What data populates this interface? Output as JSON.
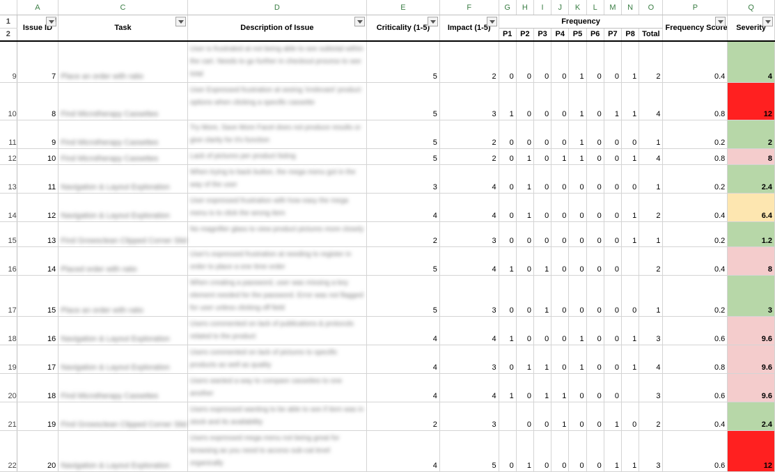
{
  "columns": [
    "A",
    "C",
    "D",
    "E",
    "F",
    "G",
    "H",
    "I",
    "J",
    "K",
    "L",
    "M",
    "N",
    "O",
    "P",
    "Q"
  ],
  "headers": {
    "issue_id": "Issue ID",
    "task": "Task",
    "description": "Description of Issue",
    "criticality": "Criticality (1-5)",
    "impact": "Impact (1-5)",
    "frequency": "Frequency",
    "p_labels": [
      "P1",
      "P2",
      "P3",
      "P4",
      "P5",
      "P6",
      "P7",
      "P8",
      "Total"
    ],
    "frequency_score": "Frequency Score",
    "severity": "Severity"
  },
  "header_rows": [
    "1",
    "2"
  ],
  "rows": [
    {
      "row": "9",
      "id": "7",
      "task": "Place an order with ratio",
      "desc": "User is frustrated at not being able to see subtotal within the cart. Needs to go further in checkout process to see total",
      "crit": "5",
      "impact": "2",
      "p": [
        "0",
        "0",
        "0",
        "0",
        "1",
        "0",
        "0",
        "1"
      ],
      "total": "2",
      "fscore": "0.4",
      "sev": "4",
      "sevclass": "g"
    },
    {
      "row": "10",
      "id": "8",
      "task": "Find Microtherapy Cassettes",
      "desc": "User Expressed frustration at seeing 'irrelevant' product options when clicking a specific cassette",
      "crit": "5",
      "impact": "3",
      "p": [
        "1",
        "0",
        "0",
        "0",
        "1",
        "0",
        "1",
        "1"
      ],
      "total": "4",
      "fscore": "0.8",
      "sev": "12",
      "sevclass": "r"
    },
    {
      "row": "11",
      "id": "9",
      "task": "Find Microtherapy Cassettes",
      "desc": "Try More, Save More Facet does not produce results or give clarity for it's function",
      "crit": "5",
      "impact": "2",
      "p": [
        "0",
        "0",
        "0",
        "0",
        "1",
        "0",
        "0",
        "0"
      ],
      "total": "1",
      "fscore": "0.2",
      "sev": "2",
      "sevclass": "g"
    },
    {
      "row": "12",
      "id": "10",
      "task": "Find Microtherapy Cassettes",
      "desc": "Lack of pictures per product listing",
      "crit": "5",
      "impact": "2",
      "p": [
        "0",
        "1",
        "0",
        "1",
        "1",
        "0",
        "0",
        "1"
      ],
      "total": "4",
      "fscore": "0.8",
      "sev": "8",
      "sevclass": "p"
    },
    {
      "row": "13",
      "id": "11",
      "task": "Navigation & Layout Exploration",
      "desc": "When trying to back button, the mega menu got in the way of the user",
      "crit": "3",
      "impact": "4",
      "p": [
        "0",
        "1",
        "0",
        "0",
        "0",
        "0",
        "0",
        "0"
      ],
      "total": "1",
      "fscore": "0.2",
      "sev": "2.4",
      "sevclass": "g"
    },
    {
      "row": "14",
      "id": "12",
      "task": "Navigation & Layout Exploration",
      "desc": "User expressed frustration with how easy the mega menu is to click the wrong item",
      "crit": "4",
      "impact": "4",
      "p": [
        "0",
        "1",
        "0",
        "0",
        "0",
        "0",
        "0",
        "1"
      ],
      "total": "2",
      "fscore": "0.4",
      "sev": "6.4",
      "sevclass": "y"
    },
    {
      "row": "15",
      "id": "13",
      "task": "Find Growsclean Clipped Corner Slides",
      "desc": "No magnifier glass to view product pictures more closely",
      "crit": "2",
      "impact": "3",
      "p": [
        "0",
        "0",
        "0",
        "0",
        "0",
        "0",
        "0",
        "1"
      ],
      "total": "1",
      "fscore": "0.2",
      "sev": "1.2",
      "sevclass": "g"
    },
    {
      "row": "16",
      "id": "14",
      "task": "Placed order with ratio",
      "desc": "User's expressed frustration at needing to register in order to place a one time order",
      "crit": "5",
      "impact": "4",
      "p": [
        "1",
        "0",
        "1",
        "0",
        "0",
        "0",
        "0",
        ""
      ],
      "total": "2",
      "fscore": "0.4",
      "sev": "8",
      "sevclass": "p"
    },
    {
      "row": "17",
      "id": "15",
      "task": "Place an order with ratio",
      "desc": "When creating a password, user was missing a key element needed for the password. Error was not flagged for user unless clicking off field",
      "crit": "5",
      "impact": "3",
      "p": [
        "0",
        "0",
        "1",
        "0",
        "0",
        "0",
        "0",
        "0"
      ],
      "total": "1",
      "fscore": "0.2",
      "sev": "3",
      "sevclass": "g"
    },
    {
      "row": "18",
      "id": "16",
      "task": "Navigation & Layout Exploration",
      "desc": "Users commented on lack of publications & protocols related to the product",
      "crit": "4",
      "impact": "4",
      "p": [
        "1",
        "0",
        "0",
        "0",
        "1",
        "0",
        "0",
        "1"
      ],
      "total": "3",
      "fscore": "0.6",
      "sev": "9.6",
      "sevclass": "p"
    },
    {
      "row": "19",
      "id": "17",
      "task": "Navigation & Layout Exploration",
      "desc": "Users commented on lack of pictures to specific products as well as quality",
      "crit": "4",
      "impact": "3",
      "p": [
        "0",
        "1",
        "1",
        "0",
        "1",
        "0",
        "0",
        "1"
      ],
      "total": "4",
      "fscore": "0.8",
      "sev": "9.6",
      "sevclass": "p"
    },
    {
      "row": "20",
      "id": "18",
      "task": "Find Microtherapy Cassettes",
      "desc": "Users wanted a way to compare cassettes to one another",
      "crit": "4",
      "impact": "4",
      "p": [
        "1",
        "0",
        "1",
        "1",
        "0",
        "0",
        "0",
        ""
      ],
      "total": "3",
      "fscore": "0.6",
      "sev": "9.6",
      "sevclass": "p"
    },
    {
      "row": "21",
      "id": "19",
      "task": "Find Growsclean Clipped Corner Slides",
      "desc": "Users expressed wanting to be able to see if item was in stock and its availability",
      "crit": "2",
      "impact": "3",
      "p": [
        "",
        "0",
        "0",
        "1",
        "0",
        "0",
        "1",
        "0"
      ],
      "total": "2",
      "fscore": "0.4",
      "sev": "2.4",
      "sevclass": "g"
    },
    {
      "row": "22",
      "id": "20",
      "task": "Navigation & Layout Exploration",
      "desc": "Users expressed mega menu not being great for browsing as you need to access sub-cat level organically",
      "crit": "4",
      "impact": "5",
      "p": [
        "0",
        "1",
        "0",
        "0",
        "0",
        "0",
        "1",
        "1"
      ],
      "total": "3",
      "fscore": "0.6",
      "sev": "12",
      "sevclass": "r"
    }
  ]
}
